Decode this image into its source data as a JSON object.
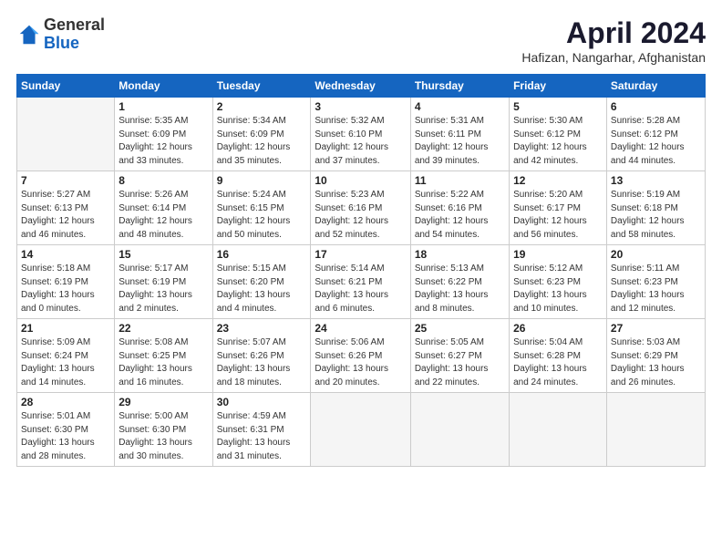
{
  "logo": {
    "general": "General",
    "blue": "Blue"
  },
  "header": {
    "month": "April 2024",
    "location": "Hafizan, Nangarhar, Afghanistan"
  },
  "weekdays": [
    "Sunday",
    "Monday",
    "Tuesday",
    "Wednesday",
    "Thursday",
    "Friday",
    "Saturday"
  ],
  "weeks": [
    [
      {
        "day": "",
        "info": ""
      },
      {
        "day": "1",
        "info": "Sunrise: 5:35 AM\nSunset: 6:09 PM\nDaylight: 12 hours\nand 33 minutes."
      },
      {
        "day": "2",
        "info": "Sunrise: 5:34 AM\nSunset: 6:09 PM\nDaylight: 12 hours\nand 35 minutes."
      },
      {
        "day": "3",
        "info": "Sunrise: 5:32 AM\nSunset: 6:10 PM\nDaylight: 12 hours\nand 37 minutes."
      },
      {
        "day": "4",
        "info": "Sunrise: 5:31 AM\nSunset: 6:11 PM\nDaylight: 12 hours\nand 39 minutes."
      },
      {
        "day": "5",
        "info": "Sunrise: 5:30 AM\nSunset: 6:12 PM\nDaylight: 12 hours\nand 42 minutes."
      },
      {
        "day": "6",
        "info": "Sunrise: 5:28 AM\nSunset: 6:12 PM\nDaylight: 12 hours\nand 44 minutes."
      }
    ],
    [
      {
        "day": "7",
        "info": "Sunrise: 5:27 AM\nSunset: 6:13 PM\nDaylight: 12 hours\nand 46 minutes."
      },
      {
        "day": "8",
        "info": "Sunrise: 5:26 AM\nSunset: 6:14 PM\nDaylight: 12 hours\nand 48 minutes."
      },
      {
        "day": "9",
        "info": "Sunrise: 5:24 AM\nSunset: 6:15 PM\nDaylight: 12 hours\nand 50 minutes."
      },
      {
        "day": "10",
        "info": "Sunrise: 5:23 AM\nSunset: 6:16 PM\nDaylight: 12 hours\nand 52 minutes."
      },
      {
        "day": "11",
        "info": "Sunrise: 5:22 AM\nSunset: 6:16 PM\nDaylight: 12 hours\nand 54 minutes."
      },
      {
        "day": "12",
        "info": "Sunrise: 5:20 AM\nSunset: 6:17 PM\nDaylight: 12 hours\nand 56 minutes."
      },
      {
        "day": "13",
        "info": "Sunrise: 5:19 AM\nSunset: 6:18 PM\nDaylight: 12 hours\nand 58 minutes."
      }
    ],
    [
      {
        "day": "14",
        "info": "Sunrise: 5:18 AM\nSunset: 6:19 PM\nDaylight: 13 hours\nand 0 minutes."
      },
      {
        "day": "15",
        "info": "Sunrise: 5:17 AM\nSunset: 6:19 PM\nDaylight: 13 hours\nand 2 minutes."
      },
      {
        "day": "16",
        "info": "Sunrise: 5:15 AM\nSunset: 6:20 PM\nDaylight: 13 hours\nand 4 minutes."
      },
      {
        "day": "17",
        "info": "Sunrise: 5:14 AM\nSunset: 6:21 PM\nDaylight: 13 hours\nand 6 minutes."
      },
      {
        "day": "18",
        "info": "Sunrise: 5:13 AM\nSunset: 6:22 PM\nDaylight: 13 hours\nand 8 minutes."
      },
      {
        "day": "19",
        "info": "Sunrise: 5:12 AM\nSunset: 6:23 PM\nDaylight: 13 hours\nand 10 minutes."
      },
      {
        "day": "20",
        "info": "Sunrise: 5:11 AM\nSunset: 6:23 PM\nDaylight: 13 hours\nand 12 minutes."
      }
    ],
    [
      {
        "day": "21",
        "info": "Sunrise: 5:09 AM\nSunset: 6:24 PM\nDaylight: 13 hours\nand 14 minutes."
      },
      {
        "day": "22",
        "info": "Sunrise: 5:08 AM\nSunset: 6:25 PM\nDaylight: 13 hours\nand 16 minutes."
      },
      {
        "day": "23",
        "info": "Sunrise: 5:07 AM\nSunset: 6:26 PM\nDaylight: 13 hours\nand 18 minutes."
      },
      {
        "day": "24",
        "info": "Sunrise: 5:06 AM\nSunset: 6:26 PM\nDaylight: 13 hours\nand 20 minutes."
      },
      {
        "day": "25",
        "info": "Sunrise: 5:05 AM\nSunset: 6:27 PM\nDaylight: 13 hours\nand 22 minutes."
      },
      {
        "day": "26",
        "info": "Sunrise: 5:04 AM\nSunset: 6:28 PM\nDaylight: 13 hours\nand 24 minutes."
      },
      {
        "day": "27",
        "info": "Sunrise: 5:03 AM\nSunset: 6:29 PM\nDaylight: 13 hours\nand 26 minutes."
      }
    ],
    [
      {
        "day": "28",
        "info": "Sunrise: 5:01 AM\nSunset: 6:30 PM\nDaylight: 13 hours\nand 28 minutes."
      },
      {
        "day": "29",
        "info": "Sunrise: 5:00 AM\nSunset: 6:30 PM\nDaylight: 13 hours\nand 30 minutes."
      },
      {
        "day": "30",
        "info": "Sunrise: 4:59 AM\nSunset: 6:31 PM\nDaylight: 13 hours\nand 31 minutes."
      },
      {
        "day": "",
        "info": ""
      },
      {
        "day": "",
        "info": ""
      },
      {
        "day": "",
        "info": ""
      },
      {
        "day": "",
        "info": ""
      }
    ]
  ]
}
